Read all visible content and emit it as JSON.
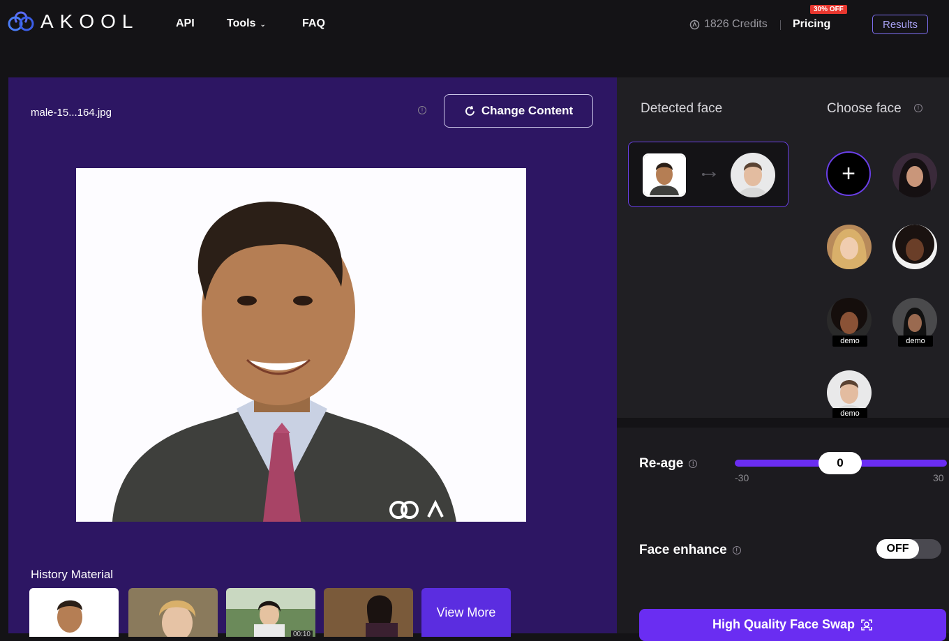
{
  "header": {
    "logo_text": "AKOOL",
    "nav": [
      {
        "label": "API"
      },
      {
        "label": "Tools",
        "has_dropdown": true
      },
      {
        "label": "FAQ"
      }
    ],
    "credits_text": "1826 Credits",
    "pricing_label": "Pricing",
    "pricing_badge": "30% OFF",
    "results_label": "Results"
  },
  "content": {
    "filename": "male-15...164.jpg",
    "change_button": "Change Content",
    "history_title": "History Material",
    "history_items": [
      {
        "type": "image",
        "selected": true
      },
      {
        "type": "image"
      },
      {
        "type": "video",
        "duration": "00:10"
      },
      {
        "type": "image"
      }
    ],
    "view_more_label": "View More"
  },
  "face_panel": {
    "detected_title": "Detected face",
    "choose_title": "Choose face",
    "choose_faces": [
      {
        "kind": "add"
      },
      {
        "kind": "face"
      },
      {
        "kind": "face"
      },
      {
        "kind": "face"
      },
      {
        "kind": "face",
        "tag": "demo"
      },
      {
        "kind": "face",
        "tag": "demo"
      },
      {
        "kind": "face",
        "tag": "demo"
      }
    ]
  },
  "settings": {
    "reage_label": "Re-age",
    "reage_value": "0",
    "reage_min": "-30",
    "reage_max": "30",
    "enhance_label": "Face enhance",
    "enhance_state": "OFF",
    "submit_label": "High Quality Face Swap"
  },
  "colors": {
    "accent": "#6a2df2",
    "panel_purple": "#2d1663",
    "background": "#141316"
  }
}
